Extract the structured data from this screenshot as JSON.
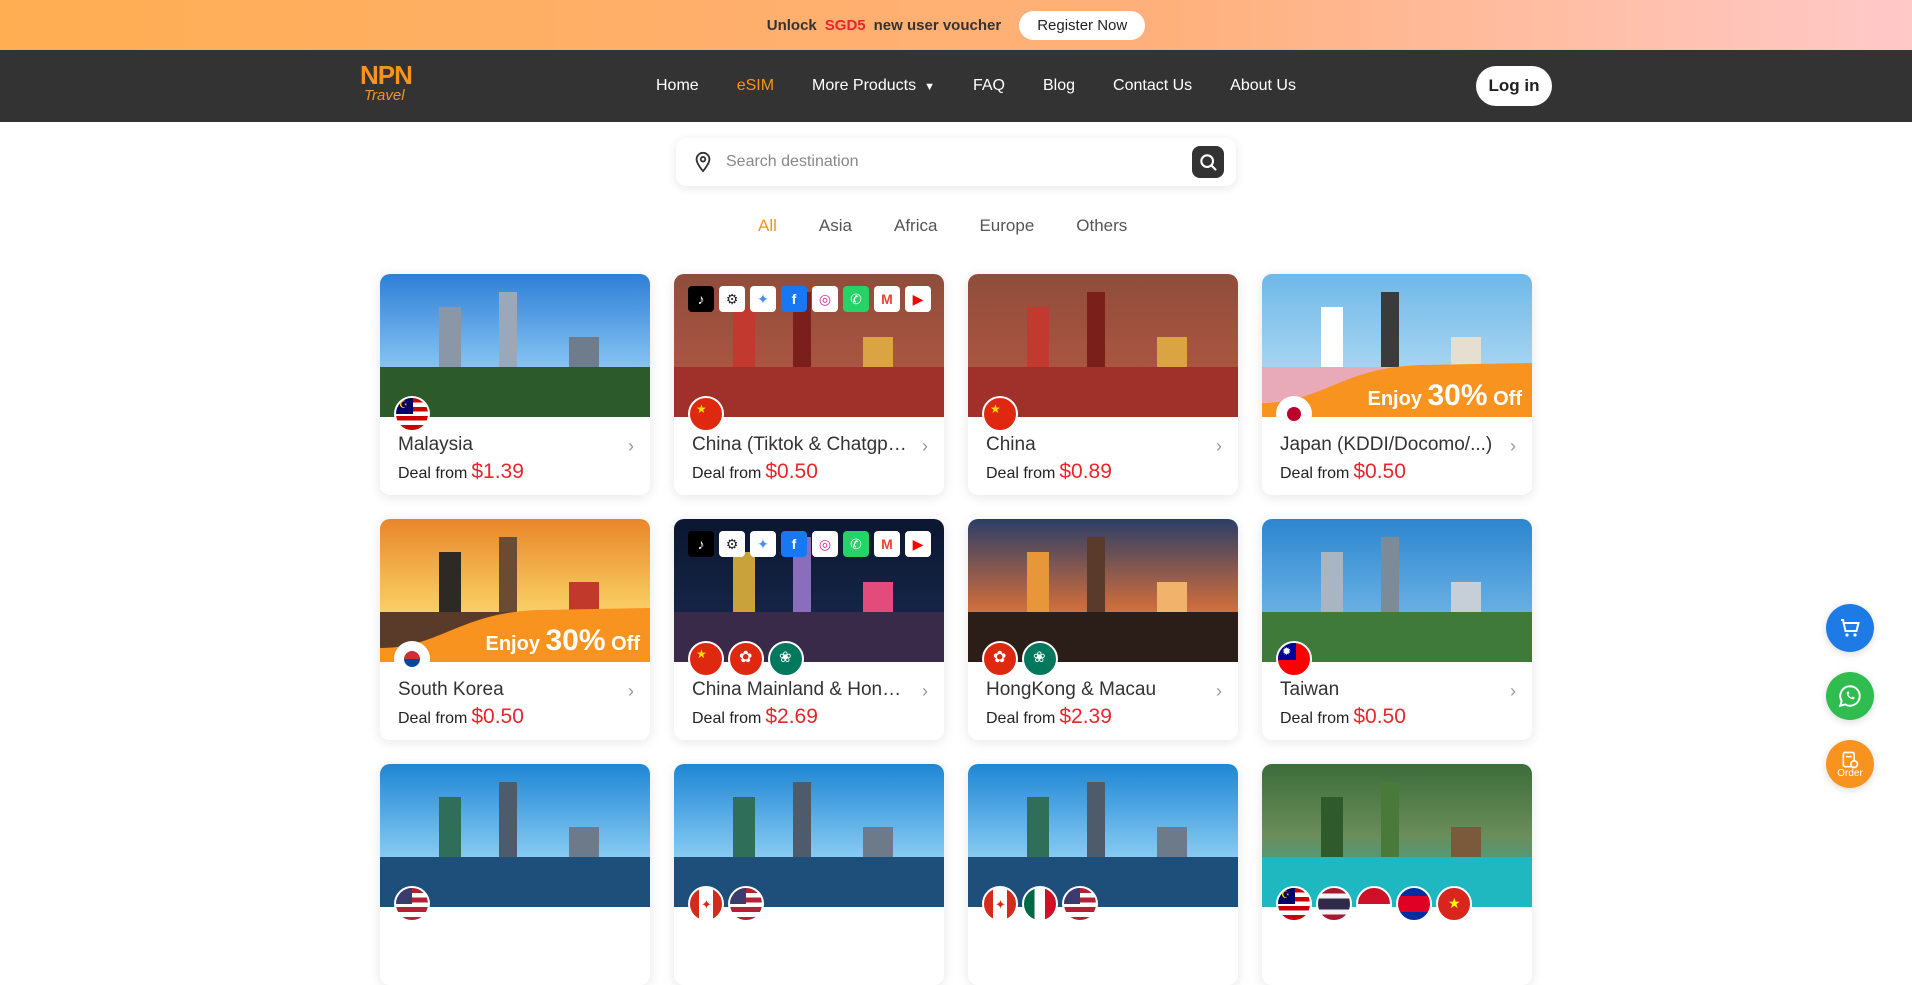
{
  "promo": {
    "prefix": "Unlock",
    "amount": "SGD5",
    "suffix": "new user voucher",
    "cta": "Register Now"
  },
  "logo": {
    "mark": "NPN",
    "word": "Travel"
  },
  "nav": [
    {
      "label": "Home"
    },
    {
      "label": "eSIM",
      "active": true
    },
    {
      "label": "More Products",
      "dropdown": true
    },
    {
      "label": "FAQ"
    },
    {
      "label": "Blog"
    },
    {
      "label": "Contact Us"
    },
    {
      "label": "About Us"
    }
  ],
  "login_label": "Log in",
  "search": {
    "placeholder": "Search destination"
  },
  "tabs": [
    "All",
    "Asia",
    "Africa",
    "Europe",
    "Others"
  ],
  "active_tab": "All",
  "deal_label": "Deal from",
  "offer": {
    "enjoy": "Enjoy",
    "pct": "30%",
    "off": "Off"
  },
  "cards": [
    {
      "name": "Malaysia",
      "price": "$1.39",
      "scene": "kl",
      "flags": [
        "my"
      ]
    },
    {
      "name": "China (Tiktok & Chatgpt...)",
      "price": "$0.50",
      "scene": "palace",
      "flags": [
        "cn"
      ],
      "apps": true
    },
    {
      "name": "China",
      "price": "$0.89",
      "scene": "palace",
      "flags": [
        "cn"
      ]
    },
    {
      "name": "Japan (KDDI/Docomo/...)",
      "price": "$0.50",
      "scene": "japan",
      "flags": [
        "jp"
      ],
      "offer": true
    },
    {
      "name": "South Korea",
      "price": "$0.50",
      "scene": "korea",
      "flags": [
        "kr"
      ],
      "offer": true
    },
    {
      "name": "China Mainland & Hong Kong...",
      "price": "$2.69",
      "scene": "night",
      "flags": [
        "cn",
        "hk",
        "mo"
      ],
      "apps": true
    },
    {
      "name": "HongKong & Macau",
      "price": "$2.39",
      "scene": "macau",
      "flags": [
        "hk",
        "mo"
      ]
    },
    {
      "name": "Taiwan",
      "price": "$0.50",
      "scene": "taipei",
      "flags": [
        "tw"
      ]
    },
    {
      "name": "",
      "price": "",
      "scene": "nyc",
      "flags": [
        "us"
      ]
    },
    {
      "name": "",
      "price": "",
      "scene": "nyc",
      "flags": [
        "ca",
        "us"
      ]
    },
    {
      "name": "",
      "price": "",
      "scene": "nyc",
      "flags": [
        "ca",
        "mx",
        "us"
      ]
    },
    {
      "name": "",
      "price": "",
      "scene": "beach",
      "flags": [
        "my",
        "th",
        "id",
        "kh",
        "vn"
      ]
    }
  ],
  "apps": [
    "tiktok",
    "chatgpt",
    "gemini",
    "facebook",
    "instagram",
    "whatsapp",
    "gmail",
    "youtube"
  ],
  "fab": {
    "order_label": "Order"
  },
  "colors": {
    "accent": "#f7931e",
    "price": "#e8262c",
    "nav_bg": "#333333"
  }
}
